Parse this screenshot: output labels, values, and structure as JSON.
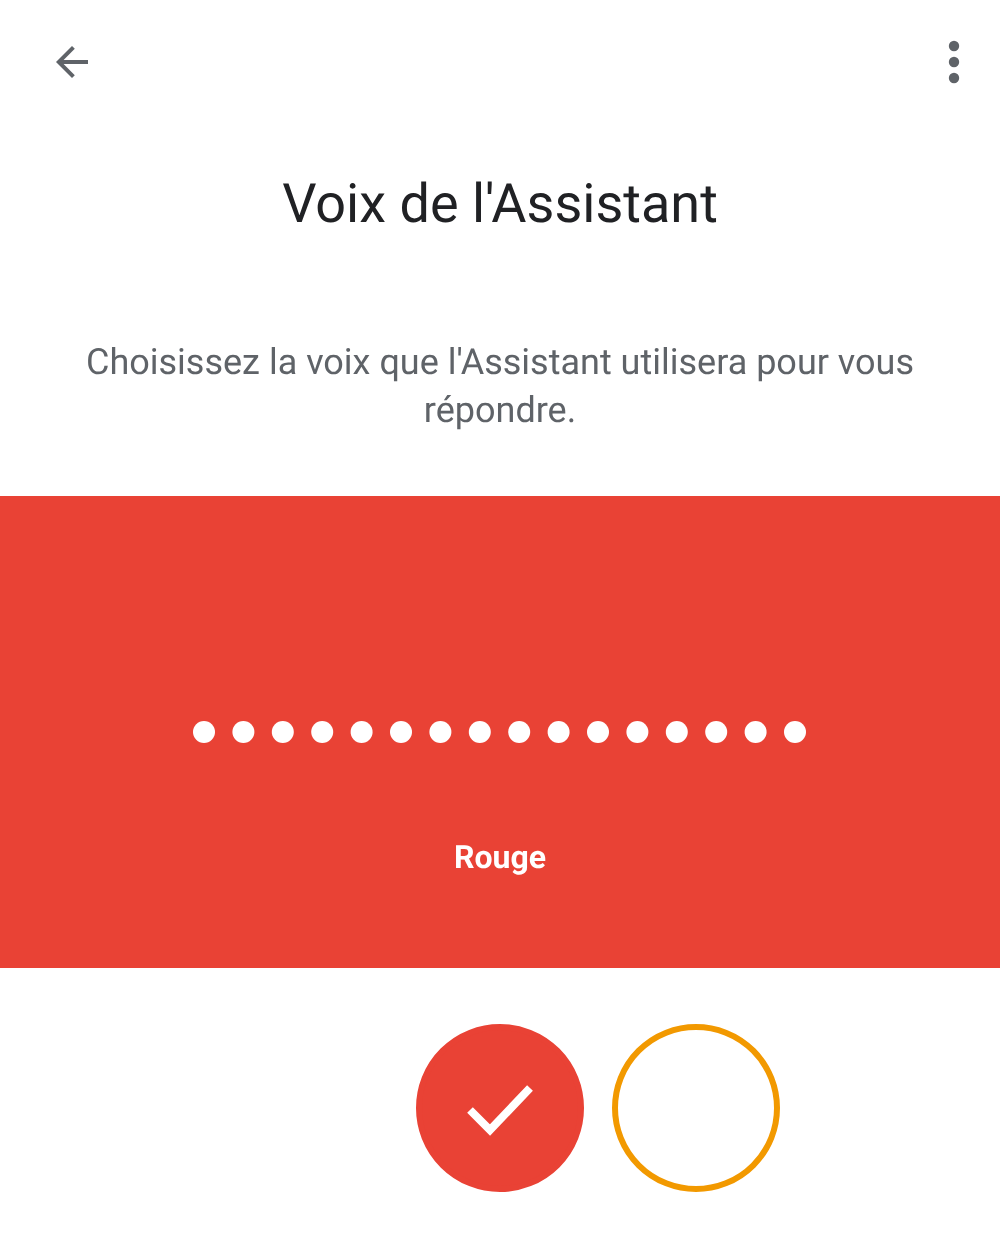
{
  "header": {
    "title": "Voix de l'Assistant",
    "description": "Choisissez la voix que l'Assistant utilisera pour vous répondre."
  },
  "voices": [
    {
      "name": "Rouge",
      "color": "#e94235",
      "selected": true
    },
    {
      "color": "#f29900",
      "selected": false
    }
  ]
}
